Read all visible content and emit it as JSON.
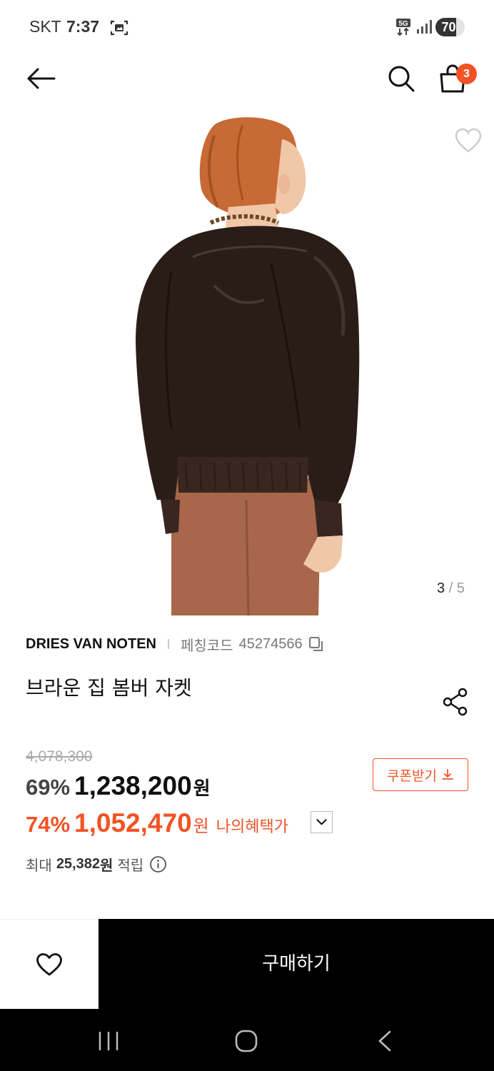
{
  "status_bar": {
    "carrier": "SKT",
    "time": "7:37",
    "network": "5G",
    "battery_level": "70",
    "battery_fraction": 0.7
  },
  "nav": {
    "back_icon": "arrow-left-icon",
    "search_icon": "search-icon",
    "cart_icon": "shopping-bag-icon",
    "cart_count": "3"
  },
  "gallery": {
    "current": "3",
    "separator": "/",
    "total": "5"
  },
  "product": {
    "brand": "DRIES VAN NOTEN",
    "code_label": "페칭코드",
    "code_value": "45274566",
    "title": "브라운 집 봄버 자켓"
  },
  "price": {
    "original": "4,078,300",
    "discount_rate": "69%",
    "sale_price": "1,238,200",
    "currency": "원",
    "benefit_rate": "74%",
    "benefit_price": "1,052,470",
    "benefit_label": "나의혜택가",
    "coupon_label": "쿠폰받기"
  },
  "points": {
    "prefix": "최대",
    "value": "25,382",
    "unit": "원",
    "suffix": "적립"
  },
  "bottom": {
    "buy_label": "구매하기"
  },
  "colors": {
    "accent": "#f25325",
    "buy_bg": "#000000"
  }
}
